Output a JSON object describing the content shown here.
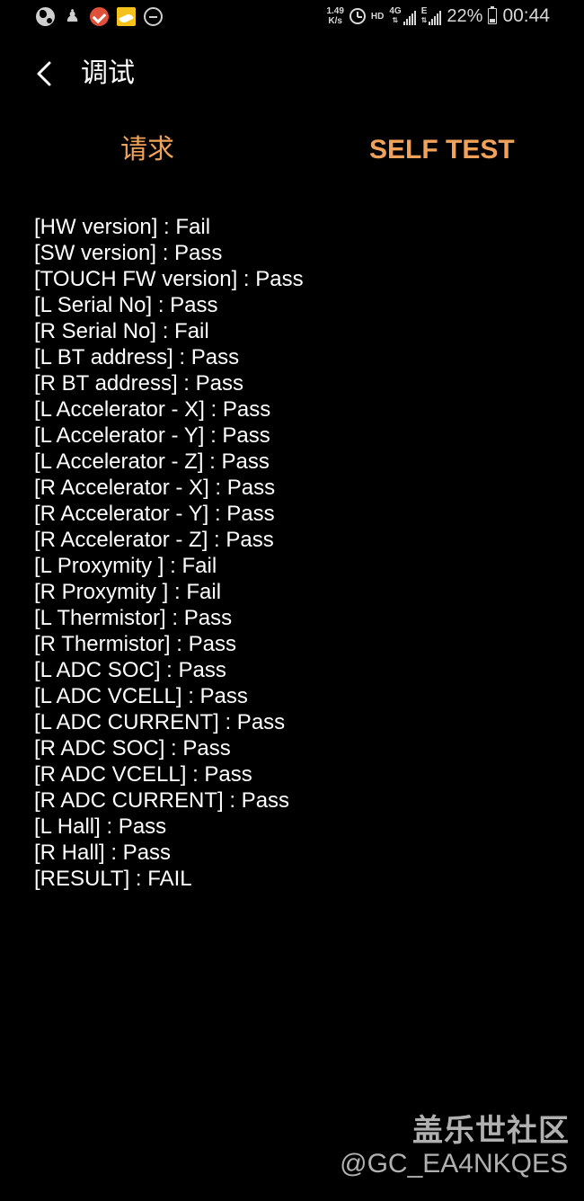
{
  "status_bar": {
    "icons_left": [
      "globe-icon",
      "walker-icon",
      "check-app-icon",
      "bird-app-icon",
      "do-not-disturb-icon"
    ],
    "speed_value": "1.49",
    "speed_unit": "K/s",
    "hd_label": "HD",
    "network_4g_label": "4G",
    "network_e_label": "E",
    "battery_percent": "22%",
    "time": "00:44"
  },
  "header": {
    "back_icon": "chevron-left-icon",
    "title": "调试"
  },
  "tabs": [
    {
      "label": "请求"
    },
    {
      "label": "SELF TEST"
    }
  ],
  "colors": {
    "accent": "#f0a25a",
    "background": "#000000",
    "text": "#ffffff"
  },
  "results": [
    "[HW version] : Fail",
    "[SW version] : Pass",
    "[TOUCH FW version] : Pass",
    "[L Serial No] : Pass",
    "[R Serial No] : Fail",
    "[L BT address] : Pass",
    "[R BT address] : Pass",
    "[L Accelerator - X] : Pass",
    "[L Accelerator - Y] : Pass",
    "[L Accelerator - Z] : Pass",
    "[R Accelerator - X] : Pass",
    "[R Accelerator - Y] : Pass",
    "[R Accelerator - Z] : Pass",
    "[L Proxymity ] : Fail",
    "[R Proxymity ] : Fail",
    "[L Thermistor] : Pass",
    "[R Thermistor] : Pass",
    "[L ADC SOC] : Pass",
    "[L ADC VCELL] : Pass",
    "[L ADC CURRENT] : Pass",
    "[R ADC SOC] : Pass",
    "[R ADC VCELL] : Pass",
    "[R ADC CURRENT] : Pass",
    "[L Hall] : Pass",
    "[R Hall] : Pass",
    "[RESULT] : FAIL"
  ],
  "watermark": {
    "logo_text": "盖乐世社区",
    "user_text": "@GC_EA4NKQES"
  }
}
